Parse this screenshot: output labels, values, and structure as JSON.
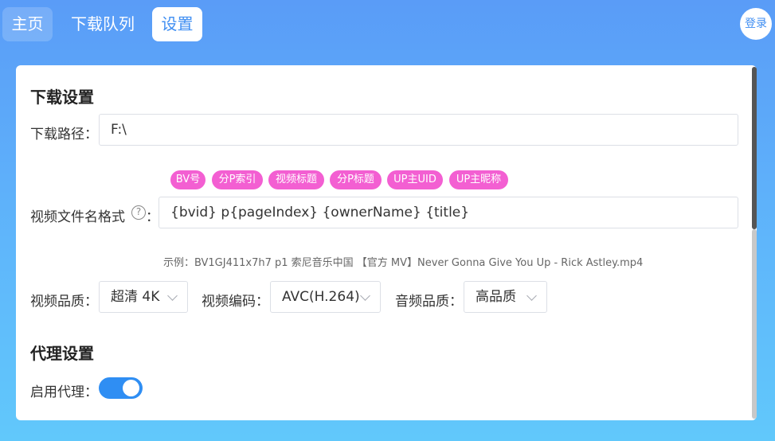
{
  "nav": {
    "tabs": [
      {
        "label": "主页"
      },
      {
        "label": "下载队列"
      },
      {
        "label": "设置"
      }
    ],
    "login_label": "登录"
  },
  "download": {
    "section_title": "下载设置",
    "path_label": "下载路径：",
    "path_value": "F:\\",
    "tags": [
      "BV号",
      "分P索引",
      "视频标题",
      "分P标题",
      "UP主UID",
      "UP主昵称"
    ],
    "filename_label": "视频文件名格式",
    "help_icon": "question-circle-icon",
    "filename_colon": "：",
    "filename_value": "{bvid} p{pageIndex} {ownerName} {title}",
    "example": "示例：BV1GJ411x7h7 p1 索尼音乐中国 【官方 MV】Never Gonna Give You Up - Rick Astley.mp4",
    "quality_label": "视频品质：",
    "quality_value": "超清 4K",
    "codec_label": "视频编码：",
    "codec_value": "AVC(H.264)",
    "audio_label": "音频品质：",
    "audio_value": "高品质"
  },
  "proxy": {
    "section_title": "代理设置",
    "enable_label": "启用代理：",
    "enabled": true
  },
  "colors": {
    "accent": "#3f8ef2",
    "tag": "#f35fd2",
    "toggle_on": "#2f8ef3"
  }
}
